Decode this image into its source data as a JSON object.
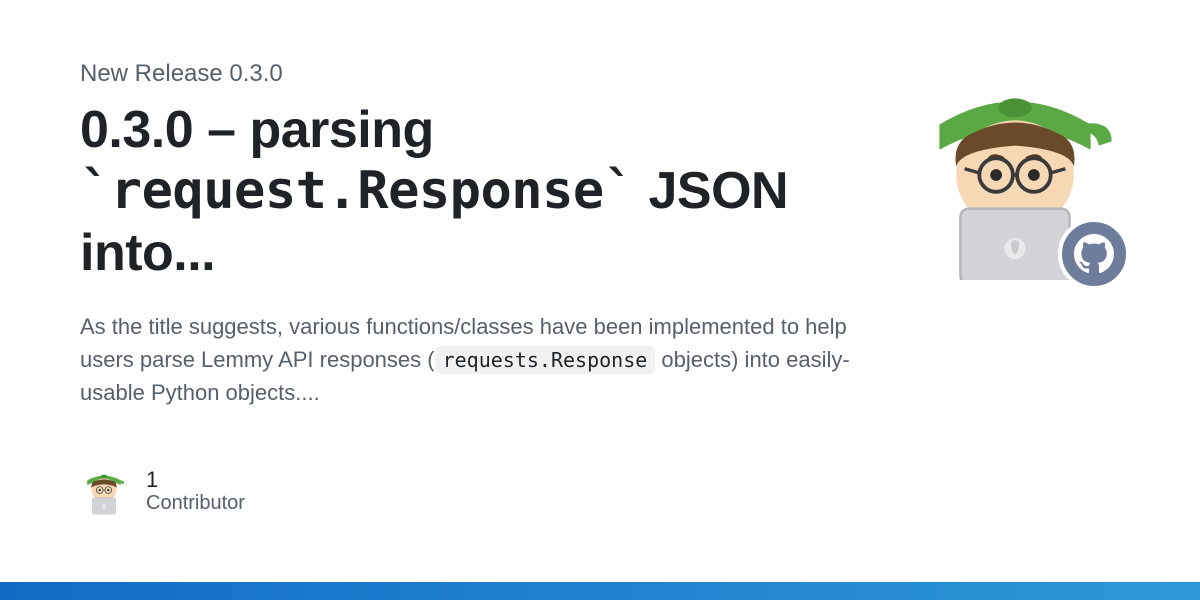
{
  "release": {
    "label": "New Release 0.3.0",
    "title_prefix": "0.3.0 – parsing ",
    "title_code": "`request.Response`",
    "title_suffix": " JSON into...",
    "description_prefix": "As the title suggests, various functions/classes have been implemented to help users parse Lemmy API responses (",
    "description_code": "requests.Response",
    "description_suffix": " objects) into easily-usable Python objects...."
  },
  "contributor": {
    "count": "1",
    "label": "Contributor",
    "avatar_icon": "technologist-emoji"
  },
  "avatar": {
    "icon": "technologist-emoji",
    "badge_icon": "github-icon"
  },
  "colors": {
    "text_primary": "#1f2328",
    "text_secondary": "#57606a",
    "accent_bar": "#126cc5",
    "badge_bg": "#6e7d9c",
    "cap_green": "#5aa944"
  }
}
